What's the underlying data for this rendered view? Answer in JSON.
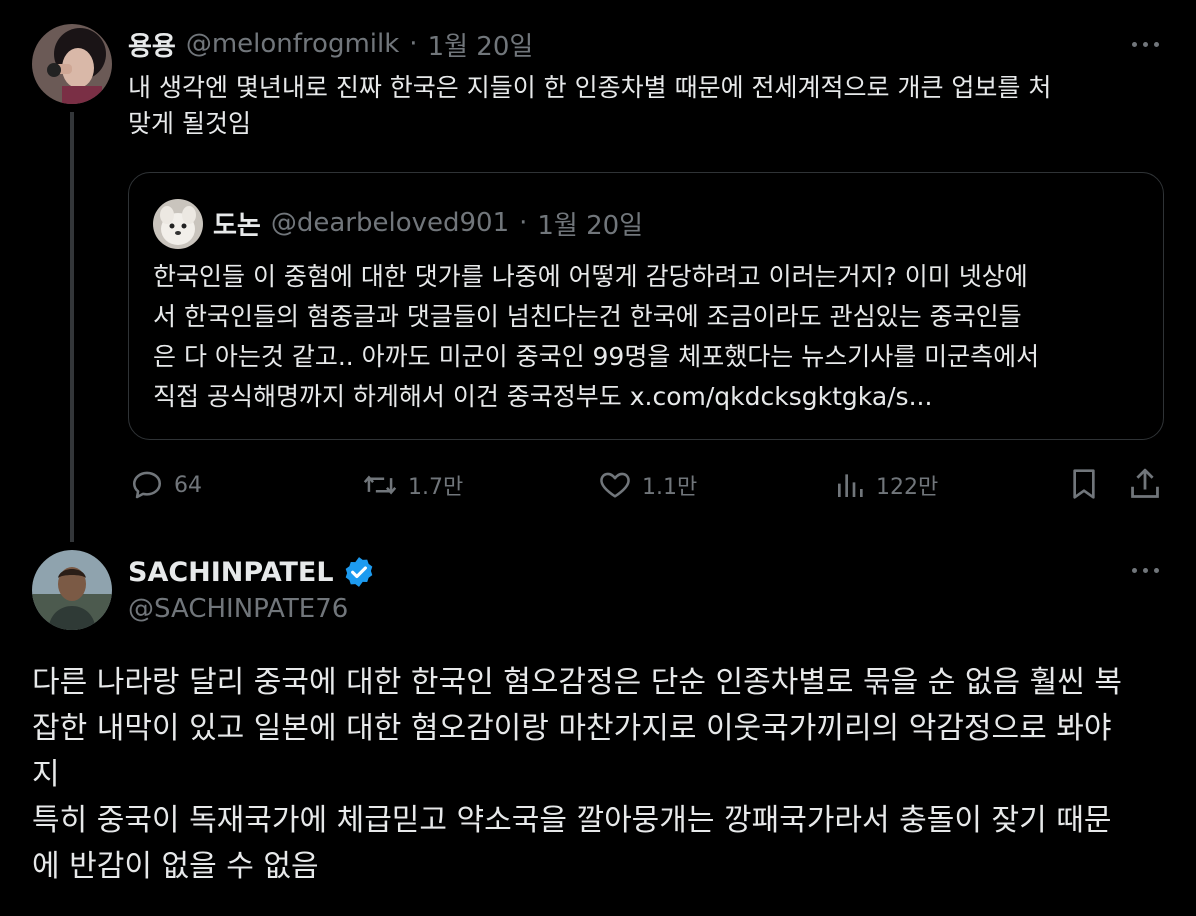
{
  "post": {
    "author_name": "용용",
    "handle": "@melonfrogmilk",
    "separator": "·",
    "date": "1월 20일",
    "text_line1": "내 생각엔 몇년내로 진짜 한국은 지들이 한 인종차별 때문에 전세계적으로 개큰 업보를 처",
    "text_line2": "맞게 될것임",
    "quote": {
      "author_name": "도논",
      "handle": "@dearbeloved901",
      "separator": "·",
      "date": "1월 20일",
      "lines": [
        "한국인들 이 중혐에 대한 댓가를 나중에 어떻게 감당하려고 이러는거지? 이미 넷상에",
        "서 한국인들의 혐중글과 댓글들이 넘친다는건 한국에 조금이라도 관심있는 중국인들",
        "은 다 아는것 같고.. 아까도 미군이 중국인 99명을 체포했다는 뉴스기사를 미군측에서",
        "직접 공식해명까지 하게해서 이건 중국정부도 x.com/qkdcksgktgka/s..."
      ]
    },
    "actions": {
      "replies": "64",
      "reposts": "1.7만",
      "likes": "1.1만",
      "views": "122만"
    }
  },
  "reply": {
    "author_name": "SACHINPATEL",
    "handle": "@SACHINPATE76",
    "verified": true,
    "lines": [
      "다른 나라랑 달리 중국에 대한 한국인 혐오감정은 단순 인종차별로 묶을 순 없음 훨씬 복",
      "잡한 내막이 있고 일본에 대한 혐오감이랑 마찬가지로 이웃국가끼리의 악감정으로 봐야",
      "지",
      "특히 중국이 독재국가에 체급믿고 약소국을 깔아뭉개는 깡패국가라서 충돌이 잦기 때문",
      "에 반감이 없을 수 없음"
    ]
  },
  "colors": {
    "background": "#000000",
    "text": "#e7e9ea",
    "muted": "#71767b",
    "border": "#2f3336",
    "verified": "#1d9bf0"
  }
}
